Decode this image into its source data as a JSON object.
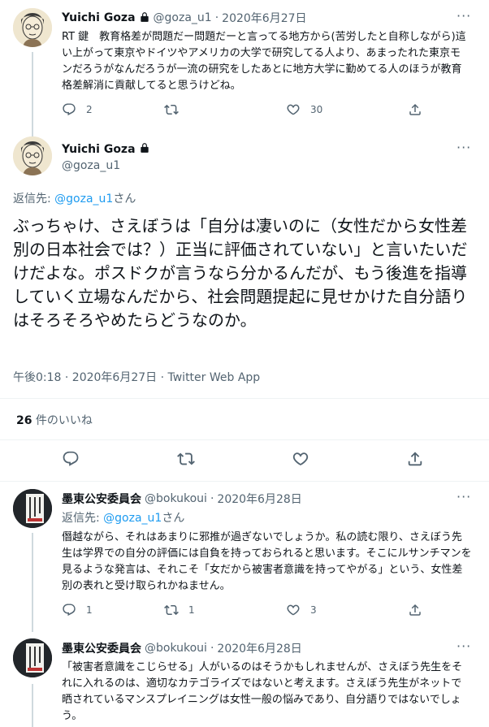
{
  "tweet1": {
    "name": "Yuichi Goza",
    "handle": "@goza_u1",
    "sep": "·",
    "date": "2020年6月27日",
    "text": "RT 鍵　教育格差が問題だー問題だーと言ってる地方から(苦労したと自称しながら)這い上がって東京やドイツやアメリカの大学で研究してる人より、あまったれた東京モンだろうがなんだろうが一流の研究をしたあとに地方大学に勤めてる人のほうが教育格差解消に貢献してると思うけどね。",
    "reply_count": "2",
    "like_count": "30"
  },
  "main_tweet": {
    "name": "Yuichi Goza",
    "handle": "@goza_u1",
    "reply_prefix": "返信先: ",
    "reply_handle": "@goza_u1",
    "reply_suffix": "さん",
    "text": "ぶっちゃけ、さえぼうは「自分は凄いのに（女性だから女性差別の日本社会では？）正当に評価されていない」と言いたいだけだよな。ポスドクが言うなら分かるんだが、もう後進を指導していく立場なんだから、社会問題提起に見せかけた自分語りはそろそろやめたらどうなのか。",
    "timestamp": "午後0:18 · 2020年6月27日 · Twitter Web App",
    "likes_count": "26",
    "likes_label": " 件のいいね"
  },
  "reply1": {
    "name": "墨東公安委員会",
    "handle": "@bokukoui",
    "sep": "·",
    "date": "2020年6月28日",
    "reply_prefix": "返信先: ",
    "reply_handle": "@goza_u1",
    "reply_suffix": "さん",
    "text": "僭越ながら、それはあまりに邪推が過ぎないでしょうか。私の読む限り、さえぼう先生は学界での自分の評価には自負を持っておられると思います。そこにルサンチマンを見るような発言は、それこそ「女だから被害者意識を持ってやがる」という、女性差別の表れと受け取られかねません。",
    "reply_count": "1",
    "retweet_count": "1",
    "like_count": "3"
  },
  "reply2": {
    "name": "墨東公安委員会",
    "handle": "@bokukoui",
    "sep": "·",
    "date": "2020年6月28日",
    "text": "「被害者意識をこじらせる」人がいるのはそうかもしれませんが、さえぼう先生をそれに入れるのは、適切なカテゴライズではないと考えます。さえぼう先生がネットで晒されているマンスプレイニングは女性一般の悩みであり、自分語りではないでしょう。"
  },
  "colors": {
    "accent": "#1d9bf0",
    "muted": "#536471",
    "text": "#0f1419",
    "divider": "#eff3f4"
  }
}
